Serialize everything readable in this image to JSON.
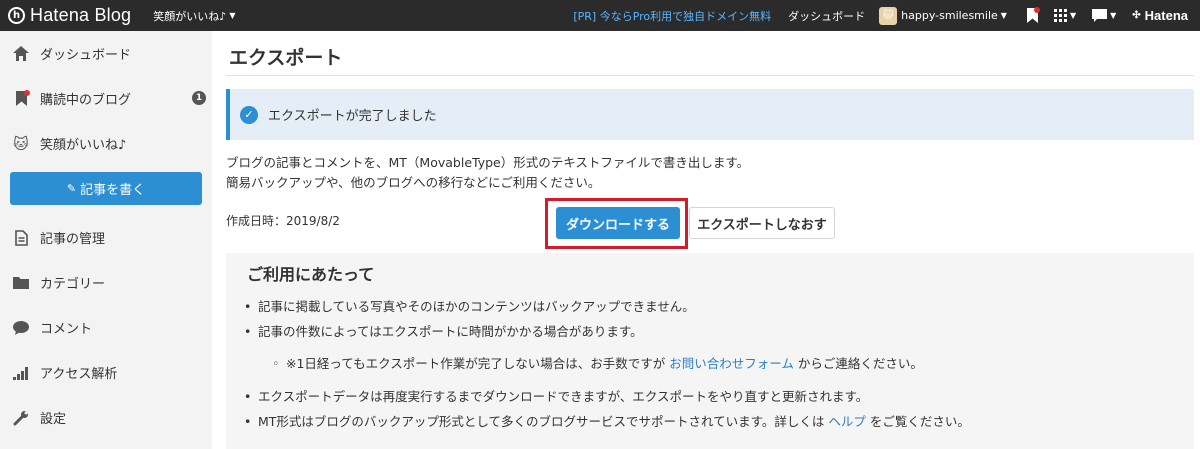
{
  "topbar": {
    "logo_mark": "h",
    "logo_text": "Hatena Blog",
    "blog_name": "笑顔がいいね♪",
    "promo": "[PR] 今ならPro利用で独自ドメイン無料",
    "dashboard": "ダッシュボード",
    "username": "happy-smilesmile",
    "brand": "Hatena"
  },
  "sidebar": {
    "items": [
      {
        "label": "ダッシュボード"
      },
      {
        "label": "購読中のブログ",
        "badge": "1"
      },
      {
        "label": "笑顔がいいね♪"
      },
      {
        "label": "記事の管理"
      },
      {
        "label": "カテゴリー"
      },
      {
        "label": "コメント"
      },
      {
        "label": "アクセス解析"
      },
      {
        "label": "設定"
      }
    ],
    "write_button": "記事を書く"
  },
  "main": {
    "title": "エクスポート",
    "notice": "エクスポートが完了しました",
    "desc_line1": "ブログの記事とコメントを、MT（MovableType）形式のテキストファイルで書き出します。",
    "desc_line2": "簡易バックアップや、他のブログへの移行などにご利用ください。",
    "created": "作成日時：2019/8/2",
    "download_button": "ダウンロードする",
    "reexport_button": "エクスポートしなおす",
    "info": {
      "title": "ご利用にあたって",
      "item1": "記事に掲載している写真やそのほかのコンテンツはバックアップできません。",
      "item2": "記事の件数によってはエクスポートに時間がかかる場合があります。",
      "sub_pre": "※1日経ってもエクスポート作業が完了しない場合は、お手数ですが ",
      "sub_link": "お問い合わせフォーム",
      "sub_post": " からご連絡ください。",
      "item3": "エクスポートデータは再度実行するまでダウンロードできますが、エクスポートをやり直すと更新されます。",
      "item4_pre": "MT形式はブログのバックアップ形式として多くのブログサービスでサポートされています。詳しくは ",
      "item4_link": "ヘルプ",
      "item4_post": " をご覧ください。"
    }
  },
  "colors": {
    "accent": "#2c8fd4",
    "highlight": "#d21c2c",
    "topbar": "#2b2b2b",
    "sidebar": "#f3f3f3"
  }
}
